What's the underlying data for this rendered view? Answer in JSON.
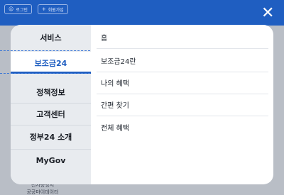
{
  "header": {
    "login_label": "로그인",
    "signup_label": "회원가입"
  },
  "footer": {
    "line1": "전자증명서",
    "line2": "공공마이데이터"
  },
  "close_icon": "close-icon",
  "menu": {
    "left": [
      {
        "label": "서비스"
      },
      {
        "label": "보조금24",
        "active": true
      },
      {
        "label": "정책정보"
      },
      {
        "label": "고객센터"
      },
      {
        "label": "정부24 소개"
      },
      {
        "label": "MyGov"
      }
    ],
    "right": [
      {
        "label": "홈"
      },
      {
        "label": "보조금24란"
      },
      {
        "label": "나의 혜택"
      },
      {
        "label": "간편 찾기"
      },
      {
        "label": "전체 혜택"
      }
    ]
  },
  "colors": {
    "brand_blue": "#1f5ec1",
    "left_panel": "#e8ebef"
  }
}
